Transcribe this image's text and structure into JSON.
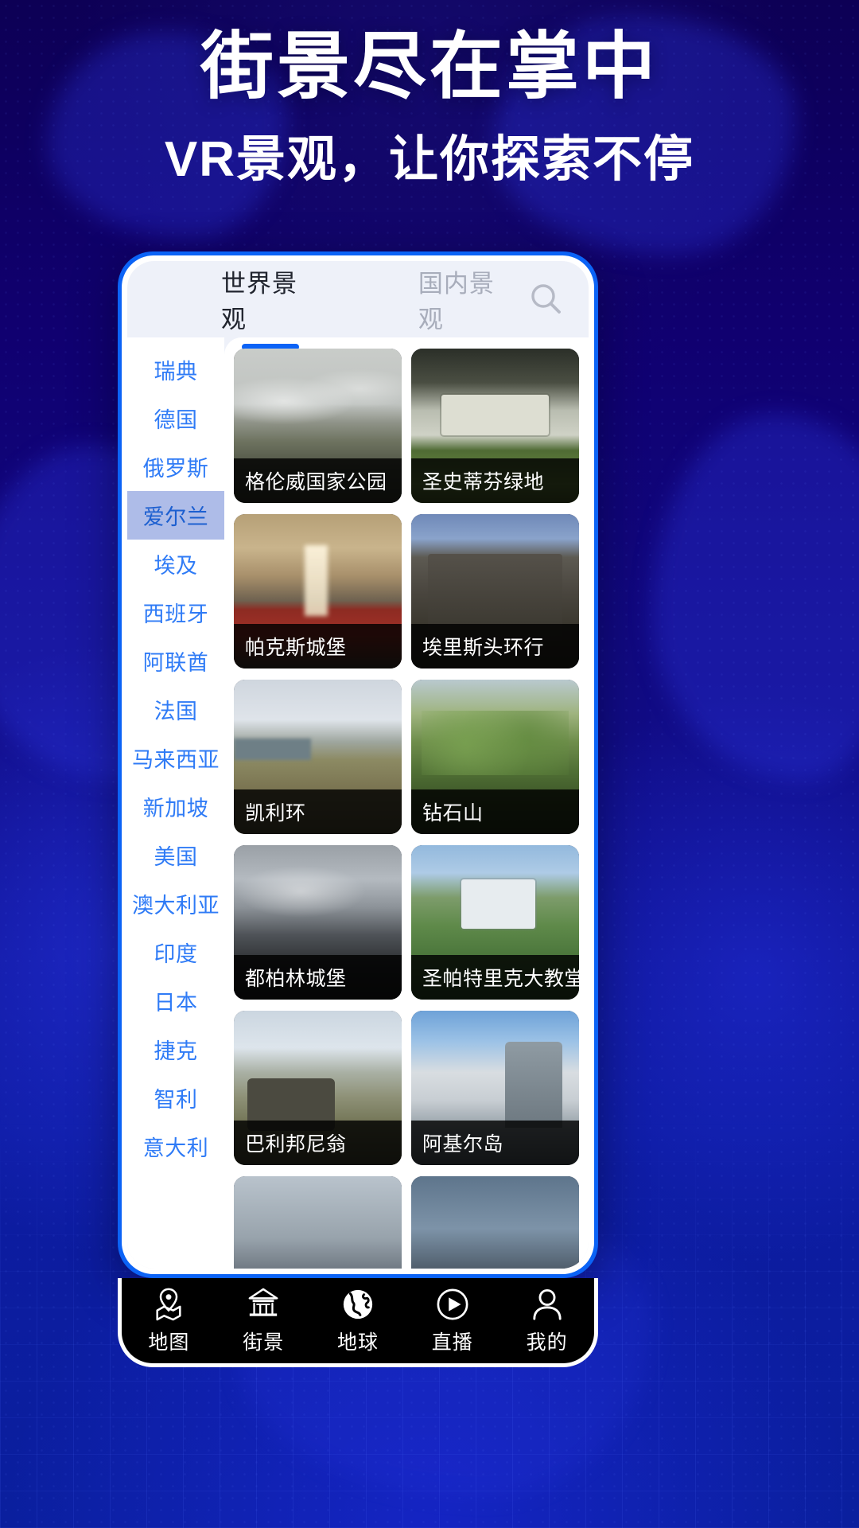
{
  "theme": {
    "bg_deep_blue": "#0d0055",
    "bg_blue": "#0a1f9e",
    "accent_blue": "#0b63f6",
    "sidebar_link": "#2f7bf6",
    "sidebar_active_bg": "#aebce8",
    "screen_bg": "#eef1f9",
    "nav_bg": "#000000"
  },
  "headline": {
    "title": "街景尽在掌中",
    "subtitle": "VR景观，让你探索不停"
  },
  "app": {
    "tabs": [
      {
        "label": "世界景观",
        "active": true
      },
      {
        "label": "国内景观",
        "active": false
      }
    ],
    "search": {
      "icon": "search-icon"
    },
    "sidebar": {
      "selected": "爱尔兰",
      "items": [
        {
          "label": "瑞典"
        },
        {
          "label": "德国"
        },
        {
          "label": "俄罗斯"
        },
        {
          "label": "爱尔兰"
        },
        {
          "label": "埃及"
        },
        {
          "label": "西班牙"
        },
        {
          "label": "阿联酋"
        },
        {
          "label": "法国"
        },
        {
          "label": "马来西亚"
        },
        {
          "label": "新加坡"
        },
        {
          "label": "美国"
        },
        {
          "label": "澳大利亚"
        },
        {
          "label": "印度"
        },
        {
          "label": "日本"
        },
        {
          "label": "捷克"
        },
        {
          "label": "智利"
        },
        {
          "label": "意大利"
        }
      ]
    },
    "cards": [
      {
        "caption": "格伦威国家公园",
        "art": "ph-glenveagh"
      },
      {
        "caption": "圣史蒂芬绿地",
        "art": "ph-stephens"
      },
      {
        "caption": "帕克斯城堡",
        "art": "ph-cashel-interior"
      },
      {
        "caption": "埃里斯头环行",
        "art": "ph-rock"
      },
      {
        "caption": "凯利环",
        "art": "ph-kerry"
      },
      {
        "caption": "钻石山",
        "art": "ph-diamond"
      },
      {
        "caption": "都柏林城堡",
        "art": "ph-dublincastle"
      },
      {
        "caption": "圣帕特里克大教堂",
        "art": "ph-patrick"
      },
      {
        "caption": "巴利邦尼翁",
        "art": "ph-ballybunion"
      },
      {
        "caption": "阿基尔岛",
        "art": "ph-achill"
      },
      {
        "caption": "",
        "art": "ph-extra-a"
      },
      {
        "caption": "",
        "art": "ph-extra-b"
      }
    ],
    "bottom_nav": [
      {
        "label": "地图",
        "icon": "map-pin-icon"
      },
      {
        "label": "街景",
        "icon": "pagoda-icon"
      },
      {
        "label": "地球",
        "icon": "globe-icon"
      },
      {
        "label": "直播",
        "icon": "play-circle-icon"
      },
      {
        "label": "我的",
        "icon": "person-icon"
      }
    ]
  }
}
